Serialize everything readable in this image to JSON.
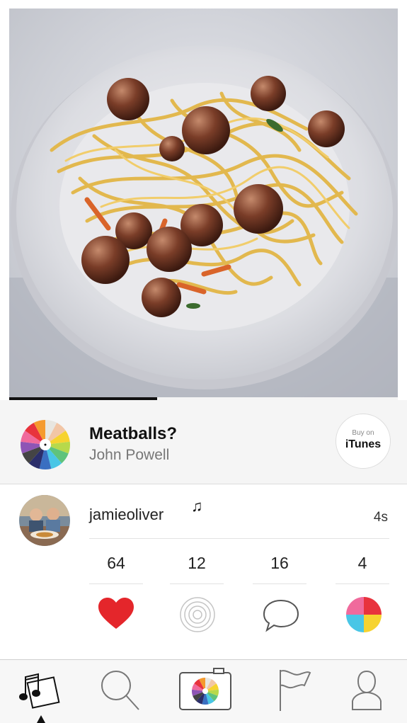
{
  "now_playing": {
    "title": "Meatballs?",
    "artist": "John Powell",
    "progress": 0.38,
    "buy_small_label": "Buy on",
    "buy_store_label": "iTunes"
  },
  "post": {
    "username": "jamieoliver",
    "time": "4s",
    "stats": {
      "likes": "64",
      "listens": "12",
      "comments": "16",
      "palettes": "4"
    }
  },
  "icons": {
    "like": "heart-icon",
    "listen": "target-icon",
    "comment": "speech-bubble-icon",
    "palette": "color-wheel-icon",
    "note": "music-note-icon"
  },
  "tabs": [
    "feed",
    "search",
    "camera",
    "flag",
    "profile"
  ],
  "colors": {
    "heart": "#e4262b",
    "progress": "#111111",
    "tab_bar": "#f7f7f7"
  }
}
